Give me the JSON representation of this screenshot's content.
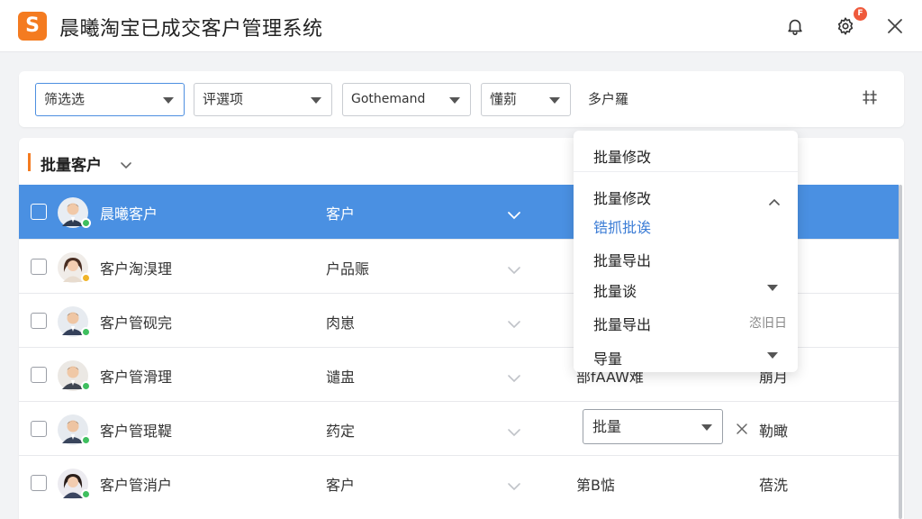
{
  "app": {
    "logo_letter": "S",
    "title": "晨曦淘宝已成交客户管理系统",
    "notification_badge": "F"
  },
  "filters": [
    {
      "value": "筛选选"
    },
    {
      "value": "评選项"
    },
    {
      "value": "Gothemand"
    },
    {
      "value": "懂莂"
    }
  ],
  "filter_label": "多户羅",
  "panel": {
    "title": "批量客户"
  },
  "rows": [
    {
      "name": "晨曦客户",
      "type": "客户",
      "c3": "",
      "c4": "",
      "status_color": "#3fbf5f",
      "selected": true
    },
    {
      "name": "客户淘湨理",
      "type": "户品赈",
      "c3": "",
      "c4": "",
      "status_color": "#f0b429"
    },
    {
      "name": "客户管砚完",
      "type": "肉崽",
      "c3": "",
      "c4": "",
      "status_color": "#3fbf5f"
    },
    {
      "name": "客户管滑理",
      "type": "谴盅",
      "c3": "部fAAW难",
      "c4": "崩月",
      "status_color": "#3fbf5f"
    },
    {
      "name": "客户管琨鞮",
      "type": "药定",
      "c3": "",
      "c4": "勒瞰",
      "inline_select": "批量",
      "status_color": "#3fbf5f"
    },
    {
      "name": "客户管消户",
      "type": "客户",
      "c3": "第B惦",
      "c4": "蓓洗",
      "status_color": "#3fbf5f"
    }
  ],
  "dropdown": {
    "header": "批量修改",
    "section1": {
      "label": "批量修改",
      "sub": "锆抓批诶"
    },
    "item_export1": "批量导出",
    "item_batch": "批量谈",
    "item_export2": "批量导出",
    "item_export2_right": "恣旧日",
    "item_count": "导量"
  },
  "colors": {
    "accent": "#f47b20",
    "selected_row": "#4a90e2",
    "link": "#3a7bd5"
  }
}
